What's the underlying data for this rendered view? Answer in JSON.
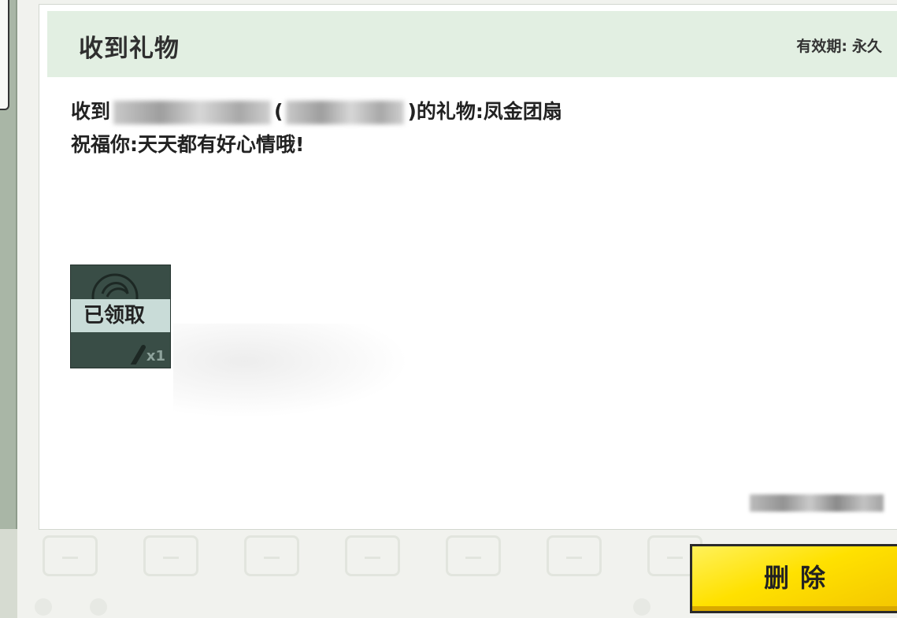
{
  "card": {
    "title": "收到礼物",
    "validity_label": "有效期:",
    "validity_value": "永久"
  },
  "message": {
    "prefix": "收到",
    "suffix": ")的礼物:凤金团扇",
    "open_paren": "(",
    "line2": "祝福你:天天都有好心情哦!"
  },
  "gift": {
    "status": "已领取",
    "quantity": "x1"
  },
  "actions": {
    "delete_label": "删除"
  }
}
